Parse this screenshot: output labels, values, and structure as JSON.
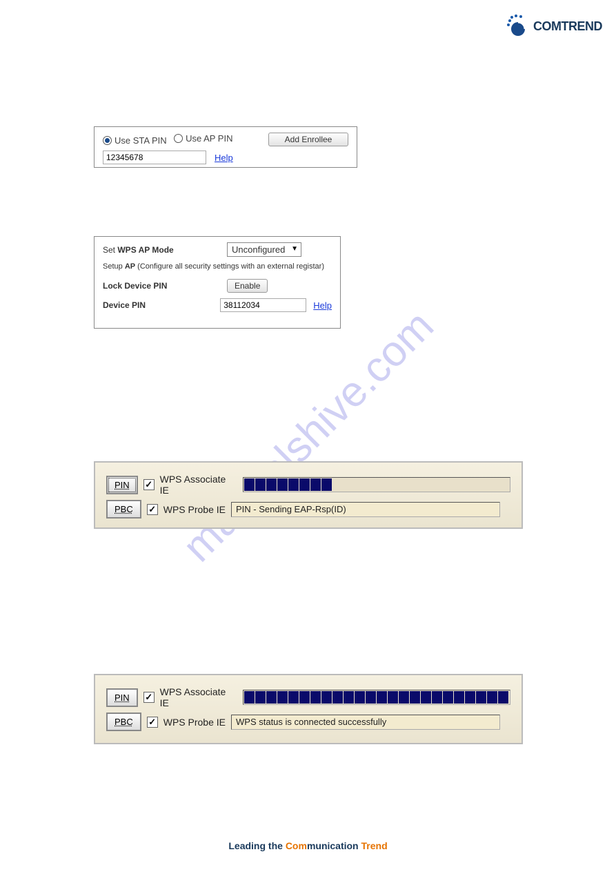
{
  "logo": {
    "text": "COMTREND"
  },
  "watermark": "manualshive.com",
  "panel1": {
    "radio_sta": "Use STA PIN",
    "radio_ap": "Use AP PIN",
    "add_enrollee_btn": "Add Enrollee",
    "pin_value": "12345678",
    "help_link": "Help"
  },
  "panel2": {
    "set_label_prefix": "Set ",
    "set_label_bold": "WPS AP Mode",
    "dropdown_value": "Unconfigured",
    "desc_prefix": "Setup ",
    "desc_bold": "AP",
    "desc_rest": " (Configure all security settings with an external registar)",
    "lock_label": "Lock Device PIN",
    "enable_btn": "Enable",
    "device_pin_label": "Device PIN",
    "device_pin_value": "38112034",
    "help_link": "Help"
  },
  "panel3": {
    "pin_btn": "PIN",
    "pbc_btn": "PBC",
    "assoc_label": "WPS Associate IE",
    "probe_label": "WPS Probe IE",
    "progress_segments": 8,
    "status_text": "PIN - Sending EAP-Rsp(ID)"
  },
  "panel4": {
    "pin_btn": "PIN",
    "pbc_btn": "PBC",
    "assoc_label": "WPS Associate IE",
    "probe_label": "WPS Probe IE",
    "progress_segments": 24,
    "status_text": "WPS status is connected successfully"
  },
  "footer": {
    "lead": "Leading the ",
    "com": "Com",
    "munication": "munication ",
    "trend": "Trend"
  }
}
